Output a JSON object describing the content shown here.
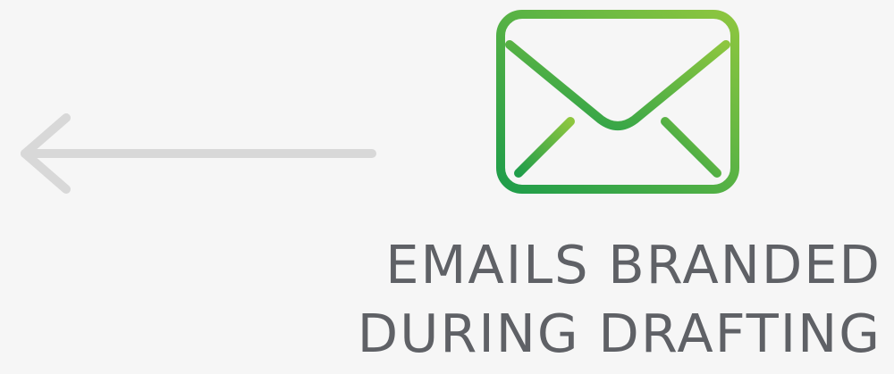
{
  "caption": {
    "line1": "EMAILS BRANDED",
    "line2": "DURING DRAFTING"
  },
  "icons": {
    "arrow": "left-arrow-icon",
    "envelope": "envelope-icon"
  },
  "colors": {
    "background": "#f6f6f6",
    "arrow": "#d8d8d8",
    "envelope_gradient_start": "#1f9d4a",
    "envelope_gradient_end": "#8dc63f",
    "caption_text": "#5f6166"
  }
}
